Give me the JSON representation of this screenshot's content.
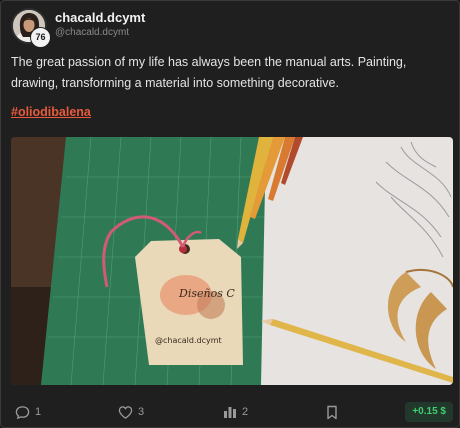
{
  "author": {
    "username": "chacald.dcymt",
    "handle": "@chacald.dcymt",
    "reputation": "76"
  },
  "post": {
    "body": "The great passion of my life has always been the manual arts. Painting, drawing, transforming a material into something decorative.",
    "hashtag": "#oliodibalena",
    "image_tag_text": "@chacald.dcymt",
    "image_logo_text": "Diseños C"
  },
  "actions": {
    "comments": "1",
    "votes": "3",
    "reblogs": "2",
    "payout": "+0.15 $"
  },
  "colors": {
    "accent": "#e85a3c",
    "payout_green": "#3ecf6e"
  },
  "icons": [
    "comment-icon",
    "heart-icon",
    "bar-chart-icon",
    "bookmark-icon"
  ]
}
